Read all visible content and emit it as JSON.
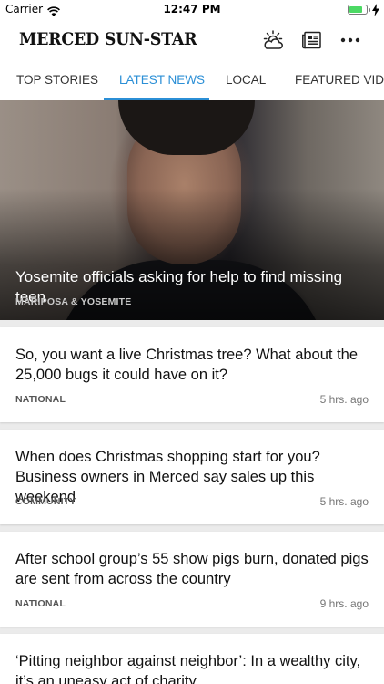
{
  "status_bar": {
    "carrier": "Carrier",
    "time": "12:47 PM",
    "battery_level": 0.8
  },
  "header": {
    "logo": "MERCED SUN-STAR",
    "icons": [
      "weather-cloud-icon",
      "newspaper-icon",
      "more-dots-icon"
    ]
  },
  "tabs": [
    {
      "label": "TOP STORIES",
      "active": false
    },
    {
      "label": "LATEST NEWS",
      "active": true
    },
    {
      "label": "LOCAL",
      "active": false
    },
    {
      "label": "FEATURED VIDEO",
      "active": false
    }
  ],
  "colors": {
    "accent": "#2b8fd6",
    "battery": "#4cd964"
  },
  "hero": {
    "title": "Yosemite officials asking for help to find missing teen",
    "category": "MARIPOSA & YOSEMITE"
  },
  "articles": [
    {
      "title": "So, you want a live Christmas tree? What about the 25,000 bugs it could have on it?",
      "category": "NATIONAL",
      "time": "5 hrs. ago"
    },
    {
      "title": "When does Christmas shopping start for you? Business owners in Merced say sales up this weekend",
      "category": "COMMUNITY",
      "time": "5 hrs. ago"
    },
    {
      "title": "After school group’s 55 show pigs burn, donated pigs are sent from across the country",
      "category": "NATIONAL",
      "time": "9 hrs. ago"
    },
    {
      "title": "‘Pitting neighbor against neighbor’: In a wealthy city, it’s an uneasy act of charity",
      "category": "",
      "time": ""
    }
  ]
}
